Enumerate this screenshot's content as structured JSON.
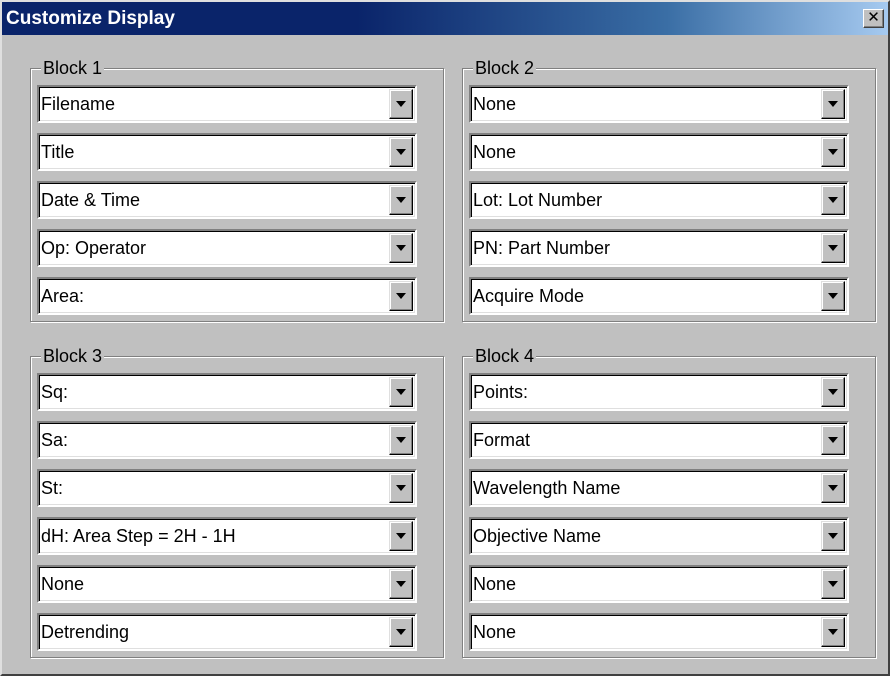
{
  "window": {
    "title": "Customize Display",
    "close_label": "✕"
  },
  "blocks": [
    {
      "label": "Block 1",
      "fields": [
        "Filename",
        "Title",
        "Date & Time",
        "Op:  Operator",
        "Area:"
      ]
    },
    {
      "label": "Block 2",
      "fields": [
        "None",
        "None",
        "Lot:  Lot Number",
        "PN:  Part Number",
        "Acquire Mode"
      ]
    },
    {
      "label": "Block 3",
      "fields": [
        "Sq:",
        "Sa:",
        "St:",
        "dH:  Area Step = 2H - 1H",
        "None",
        "Detrending"
      ]
    },
    {
      "label": "Block 4",
      "fields": [
        "Points:",
        "Format",
        "Wavelength Name",
        "Objective Name",
        "None",
        "None"
      ]
    }
  ]
}
